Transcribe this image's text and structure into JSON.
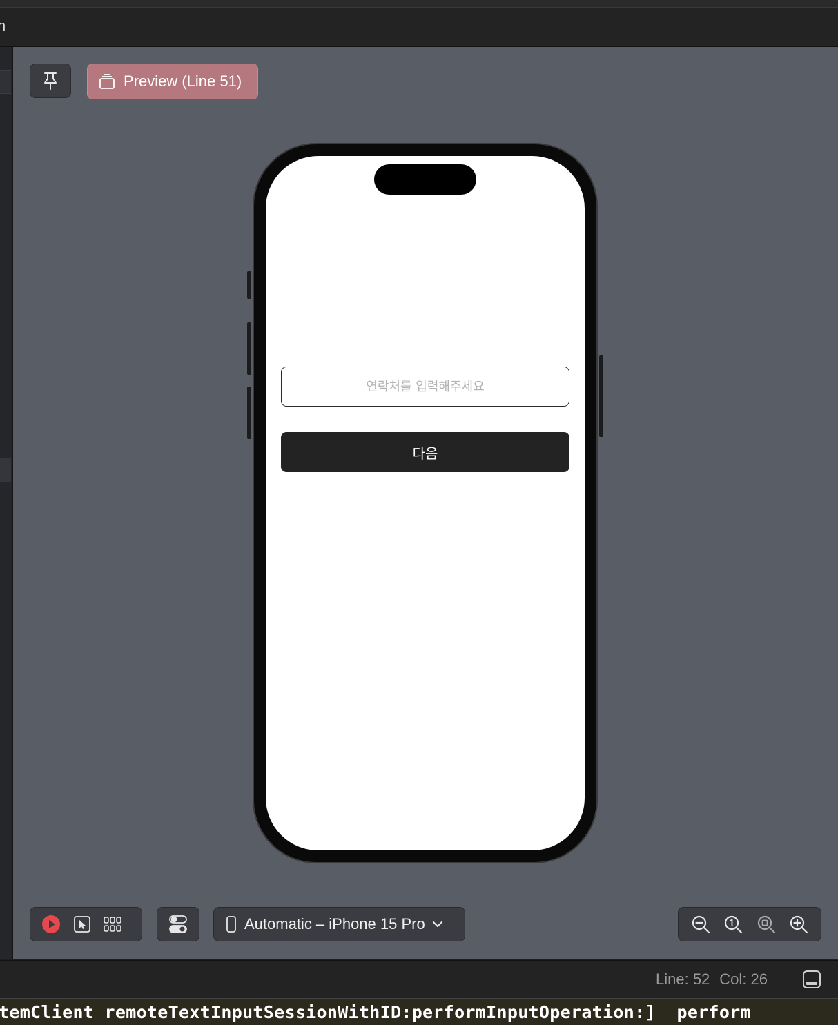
{
  "window": {
    "title_fragment": "n"
  },
  "preview_tab": {
    "label": "Preview (Line 51)"
  },
  "phone_screen": {
    "input_placeholder": "연락처를 입력해주세요",
    "next_button_label": "다음"
  },
  "toolbar": {
    "device_label": "Automatic – iPhone 15 Pro"
  },
  "status": {
    "line": "Line: 52",
    "col": "Col: 26"
  },
  "console": {
    "text": "temClient remoteTextInputSessionWithID:performInputOperation:]  perform"
  },
  "colors": {
    "canvas": "#595d65",
    "preview_tab": "#b4787e",
    "run_button": "#e5484d",
    "next_button": "#232323"
  },
  "icons": [
    "pin-icon",
    "preview-stack-icon",
    "live-preview-play-icon",
    "selectable-cursor-icon",
    "variants-grid-icon",
    "device-settings-toggle-icon",
    "iphone-icon",
    "chevron-down-icon",
    "zoom-out-icon",
    "zoom-actual-size-icon",
    "zoom-to-fit-icon",
    "zoom-in-icon",
    "toggle-bottom-panel-icon"
  ]
}
